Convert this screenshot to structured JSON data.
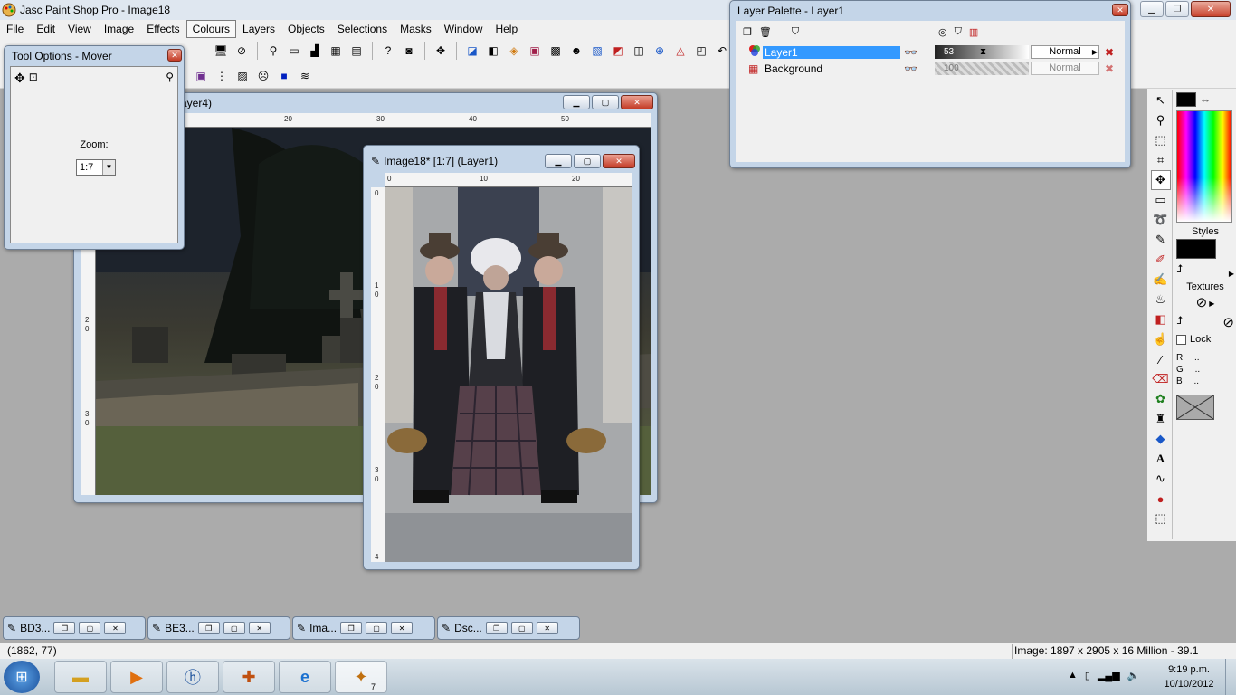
{
  "app": {
    "title": "Jasc Paint Shop Pro - Image18"
  },
  "menu": [
    "File",
    "Edit",
    "View",
    "Image",
    "Effects",
    "Colours",
    "Layers",
    "Objects",
    "Selections",
    "Masks",
    "Window",
    "Help"
  ],
  "tool_options": {
    "title": "Tool Options - Mover",
    "zoom_label": "Zoom:",
    "zoom_value": "1:7"
  },
  "image_back": {
    "title_fragment": "ayer4)",
    "ruler_labels": [
      "10",
      "20",
      "30",
      "40",
      "50"
    ],
    "vruler_labels": [
      "2",
      "0",
      "3",
      "0"
    ]
  },
  "image_front": {
    "title": "Image18* [1:7] (Layer1)",
    "ruler_labels": [
      "0",
      "10",
      "20",
      "30"
    ],
    "vruler_labels": [
      "0",
      "1",
      "0",
      "2",
      "0",
      "3",
      "0",
      "4"
    ]
  },
  "layer_palette": {
    "title": "Layer Palette - Layer1",
    "layers": [
      {
        "name": "Layer1",
        "opacity": "53",
        "blend": "Normal",
        "selected": true
      },
      {
        "name": "Background",
        "opacity": "100",
        "blend": "Normal",
        "selected": false
      }
    ]
  },
  "right_panel": {
    "styles_label": "Styles",
    "textures_label": "Textures",
    "lock_label": "Lock",
    "rgb": [
      {
        "ch": "R",
        "val": ".."
      },
      {
        "ch": "G",
        "val": ".."
      },
      {
        "ch": "B",
        "val": ".."
      }
    ]
  },
  "minimized": [
    {
      "label": "BD3..."
    },
    {
      "label": "BE3..."
    },
    {
      "label": "Ima..."
    },
    {
      "label": "Dsc..."
    }
  ],
  "status": {
    "coords": "(1862, 77)",
    "image_info": "Image:  1897 x 2905 x 16 Million - 39.1 MBytes"
  },
  "taskbar": {
    "time": "9:19 p.m.",
    "date": "10/10/2012",
    "psp_badge": "7"
  },
  "colors": {
    "accent": "#3399ff",
    "window_frame": "#c4d5e8",
    "close_red": "#c43b26"
  }
}
